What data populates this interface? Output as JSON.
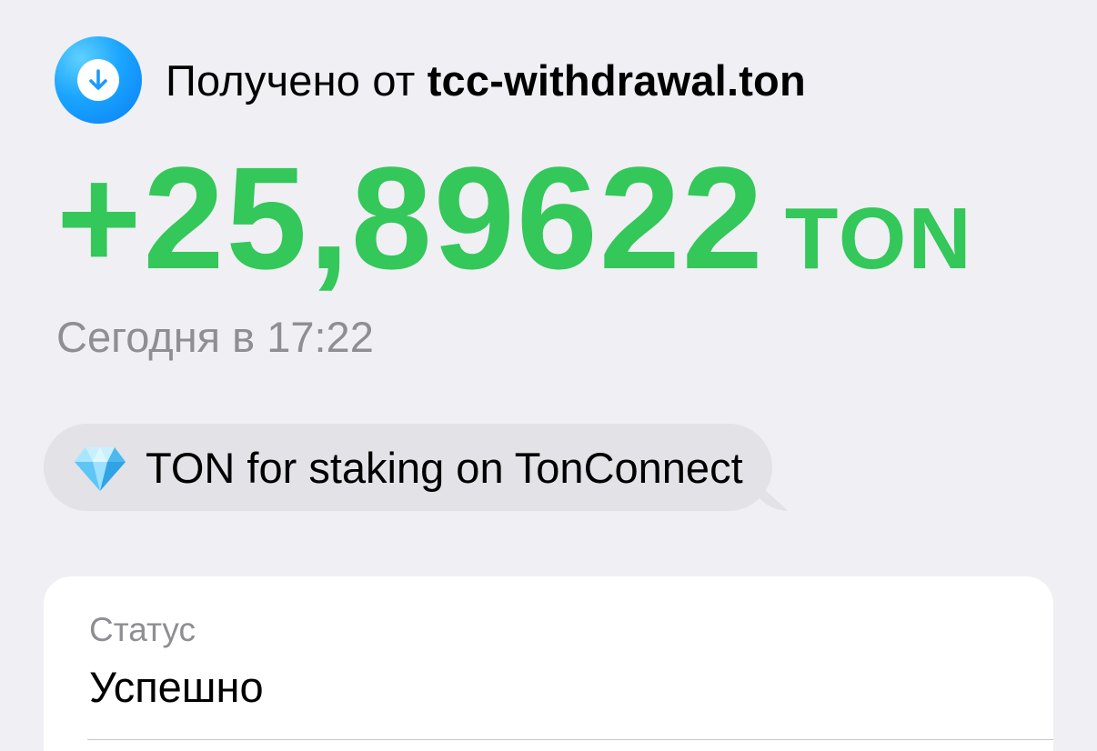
{
  "header": {
    "icon": "arrow-down-icon",
    "prefix": "Получено от ",
    "sender": "tcc-withdrawal.ton"
  },
  "amount": {
    "value": "+25,89622",
    "currency": "TON",
    "color": "#34c759"
  },
  "date": "Сегодня в 17:22",
  "comment": {
    "icon": "gem-icon",
    "text": "TON for staking on TonConnect"
  },
  "details": {
    "status_label": "Статус",
    "status_value": "Успешно"
  },
  "colors": {
    "background": "#efeff4",
    "accent_blue": "#1aa5ff",
    "secondary_text": "#8e8e93",
    "bubble": "#e2e2e7"
  }
}
